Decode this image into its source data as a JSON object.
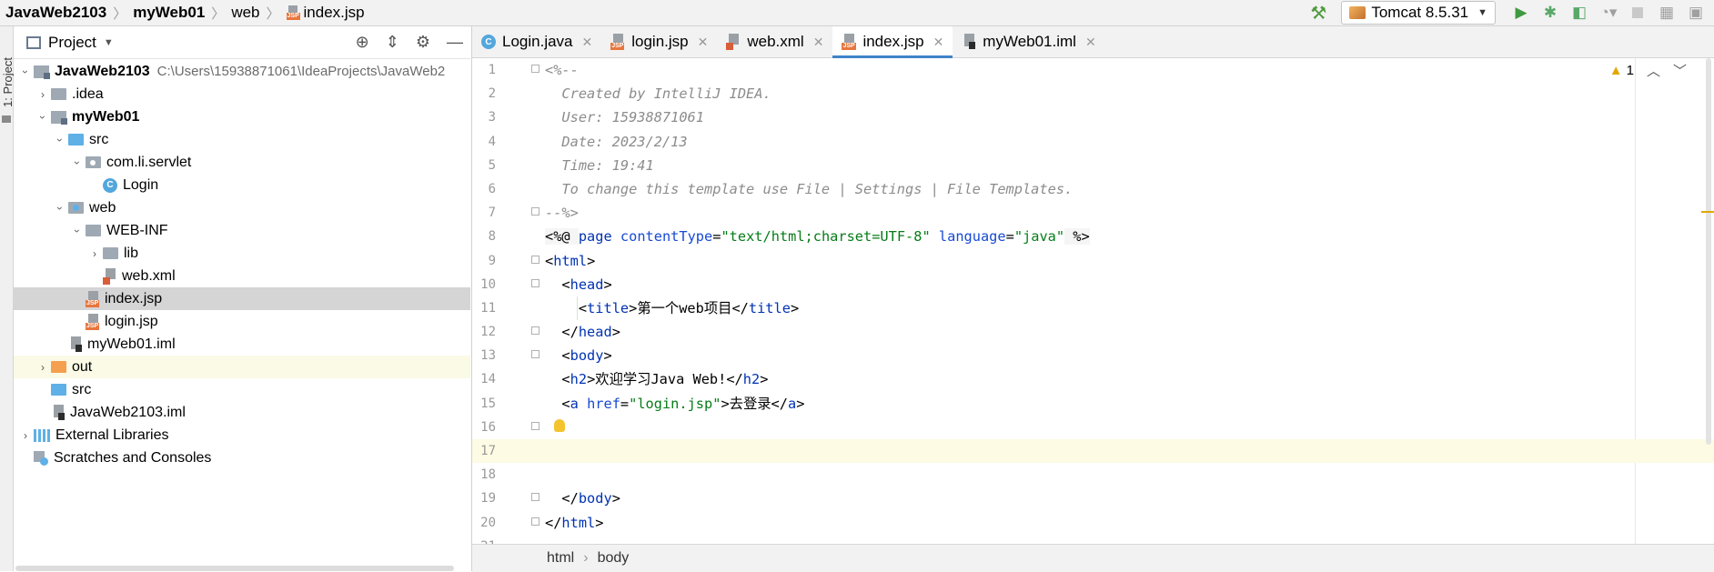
{
  "breadcrumbs": [
    "JavaWeb2103",
    "myWeb01",
    "web",
    "index.jsp"
  ],
  "run_config": {
    "label": "Tomcat 8.5.31"
  },
  "project_panel": {
    "title": "Project",
    "stripe_label": "1: Project",
    "tree": [
      {
        "label": "JavaWeb2103",
        "hint": "C:\\Users\\15938871061\\IdeaProjects\\JavaWeb2",
        "indent": 0,
        "arrow": "open",
        "icon": "module",
        "bold": true
      },
      {
        "label": ".idea",
        "indent": 1,
        "arrow": "closed",
        "icon": "folder"
      },
      {
        "label": "myWeb01",
        "indent": 1,
        "arrow": "open",
        "icon": "module",
        "bold": true
      },
      {
        "label": "src",
        "indent": 2,
        "arrow": "open",
        "icon": "folder-blue"
      },
      {
        "label": "com.li.servlet",
        "indent": 3,
        "arrow": "open",
        "icon": "folder-pkg"
      },
      {
        "label": "Login",
        "indent": 4,
        "arrow": "none",
        "icon": "class"
      },
      {
        "label": "web",
        "indent": 2,
        "arrow": "open",
        "icon": "folder-web"
      },
      {
        "label": "WEB-INF",
        "indent": 3,
        "arrow": "open",
        "icon": "folder"
      },
      {
        "label": "lib",
        "indent": 4,
        "arrow": "closed",
        "icon": "folder"
      },
      {
        "label": "web.xml",
        "indent": 4,
        "arrow": "none",
        "icon": "xml"
      },
      {
        "label": "index.jsp",
        "indent": 3,
        "arrow": "none",
        "icon": "jsp",
        "selected": true
      },
      {
        "label": "login.jsp",
        "indent": 3,
        "arrow": "none",
        "icon": "jsp"
      },
      {
        "label": "myWeb01.iml",
        "indent": 2,
        "arrow": "none",
        "icon": "iml"
      },
      {
        "label": "out",
        "indent": 1,
        "arrow": "closed",
        "icon": "folder-orange",
        "highlight": true
      },
      {
        "label": "src",
        "indent": 1,
        "arrow": "none",
        "icon": "folder-blue"
      },
      {
        "label": "JavaWeb2103.iml",
        "indent": 1,
        "arrow": "none",
        "icon": "iml"
      },
      {
        "label": "External Libraries",
        "indent": 0,
        "arrow": "closed",
        "icon": "lib"
      },
      {
        "label": "Scratches and Consoles",
        "indent": 0,
        "arrow": "none",
        "icon": "scratch"
      }
    ]
  },
  "tabs": [
    {
      "label": "Login.java",
      "icon": "class"
    },
    {
      "label": "login.jsp",
      "icon": "jsp"
    },
    {
      "label": "web.xml",
      "icon": "xml"
    },
    {
      "label": "index.jsp",
      "icon": "jsp",
      "active": true
    },
    {
      "label": "myWeb01.iml",
      "icon": "iml"
    }
  ],
  "inspection": {
    "warning_count": "1"
  },
  "code_lines": [
    [
      {
        "t": "<%--",
        "c": "cmt"
      }
    ],
    [
      {
        "t": "  Created by IntelliJ IDEA.",
        "c": "cmt"
      }
    ],
    [
      {
        "t": "  User: 15938871061",
        "c": "cmt"
      }
    ],
    [
      {
        "t": "  Date: 2023/2/13",
        "c": "cmt"
      }
    ],
    [
      {
        "t": "  Time: 19:41",
        "c": "cmt"
      }
    ],
    [
      {
        "t": "  To change this template use File | Settings | File Templates.",
        "c": "cmt"
      }
    ],
    [
      {
        "t": "--%>",
        "c": "cmt"
      }
    ],
    [
      {
        "t": "<%@ ",
        "c": "dir"
      },
      {
        "t": "page ",
        "c": "tag"
      },
      {
        "t": "contentType",
        "c": "attr"
      },
      {
        "t": "=",
        "c": ""
      },
      {
        "t": "\"text/html;charset=UTF-8\"",
        "c": "str"
      },
      {
        "t": " ",
        "c": ""
      },
      {
        "t": "language",
        "c": "attr"
      },
      {
        "t": "=",
        "c": ""
      },
      {
        "t": "\"java\"",
        "c": "str"
      },
      {
        "t": " %>",
        "c": "dir"
      }
    ],
    [
      {
        "t": "<",
        "c": ""
      },
      {
        "t": "html",
        "c": "tag"
      },
      {
        "t": ">",
        "c": ""
      }
    ],
    [
      {
        "t": "  <",
        "c": ""
      },
      {
        "t": "head",
        "c": "tag"
      },
      {
        "t": ">",
        "c": ""
      }
    ],
    [
      {
        "t": "    <",
        "c": ""
      },
      {
        "t": "title",
        "c": "tag"
      },
      {
        "t": ">第一个web项目</",
        "c": ""
      },
      {
        "t": "title",
        "c": "tag"
      },
      {
        "t": ">",
        "c": ""
      }
    ],
    [
      {
        "t": "  </",
        "c": ""
      },
      {
        "t": "head",
        "c": "tag"
      },
      {
        "t": ">",
        "c": ""
      }
    ],
    [
      {
        "t": "  <",
        "c": ""
      },
      {
        "t": "body",
        "c": "tag"
      },
      {
        "t": ">",
        "c": ""
      }
    ],
    [
      {
        "t": "  <",
        "c": ""
      },
      {
        "t": "h2",
        "c": "tag"
      },
      {
        "t": ">欢迎学习Java Web!</",
        "c": ""
      },
      {
        "t": "h2",
        "c": "tag"
      },
      {
        "t": ">",
        "c": ""
      }
    ],
    [
      {
        "t": "  <",
        "c": ""
      },
      {
        "t": "a ",
        "c": "tag"
      },
      {
        "t": "href",
        "c": "attr"
      },
      {
        "t": "=",
        "c": ""
      },
      {
        "t": "\"login.jsp\"",
        "c": "str"
      },
      {
        "t": ">去登录</",
        "c": ""
      },
      {
        "t": "a",
        "c": "tag"
      },
      {
        "t": ">",
        "c": ""
      }
    ],
    [],
    [],
    [],
    [
      {
        "t": "  </",
        "c": ""
      },
      {
        "t": "body",
        "c": "tag"
      },
      {
        "t": ">",
        "c": ""
      }
    ],
    [
      {
        "t": "</",
        "c": ""
      },
      {
        "t": "html",
        "c": "tag"
      },
      {
        "t": ">",
        "c": ""
      }
    ],
    []
  ],
  "line_numbers": [
    "1",
    "2",
    "3",
    "4",
    "5",
    "6",
    "7",
    "8",
    "9",
    "10",
    "11",
    "12",
    "13",
    "14",
    "15",
    "16",
    "17",
    "18",
    "19",
    "20",
    "21"
  ],
  "current_line": 17,
  "status_breadcrumb": [
    "html",
    "body"
  ]
}
